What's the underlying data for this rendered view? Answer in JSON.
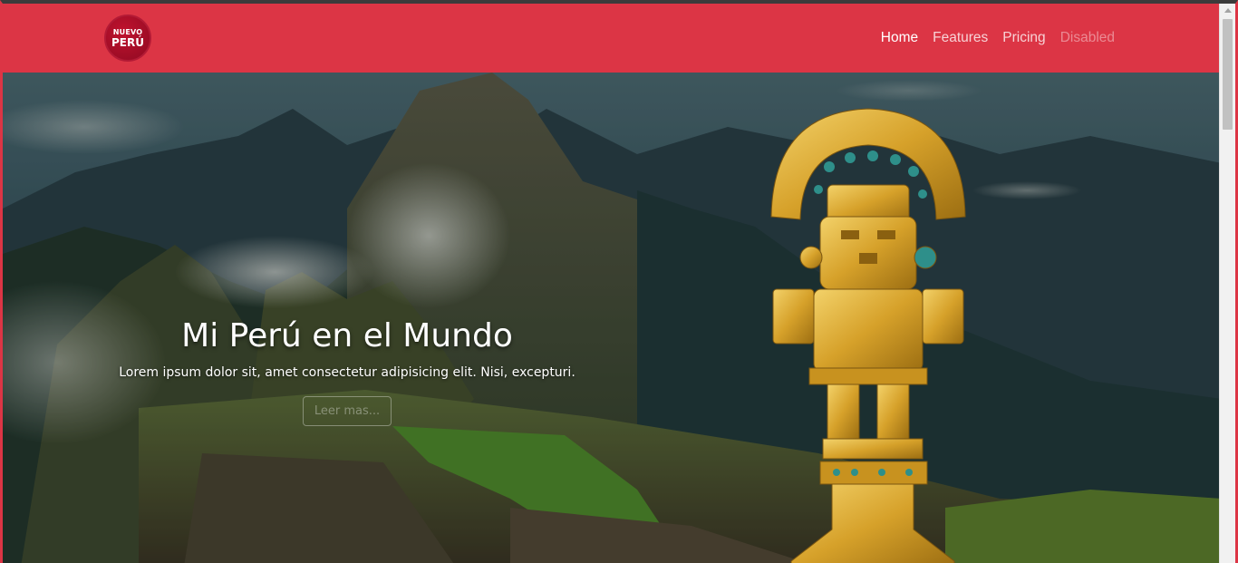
{
  "brand": {
    "logo_line1": "NUEVO",
    "logo_line2": "PERÚ",
    "color": "#dc3545"
  },
  "nav": {
    "items": [
      {
        "label": "Home",
        "state": "active"
      },
      {
        "label": "Features",
        "state": "normal"
      },
      {
        "label": "Pricing",
        "state": "normal"
      },
      {
        "label": "Disabled",
        "state": "disabled"
      }
    ]
  },
  "hero": {
    "title": "Mi Perú en el Mundo",
    "subtitle": "Lorem ipsum dolor sit, amet consectetur adipisicing elit. Nisi, excepturi.",
    "button_label": "Leer mas..."
  }
}
